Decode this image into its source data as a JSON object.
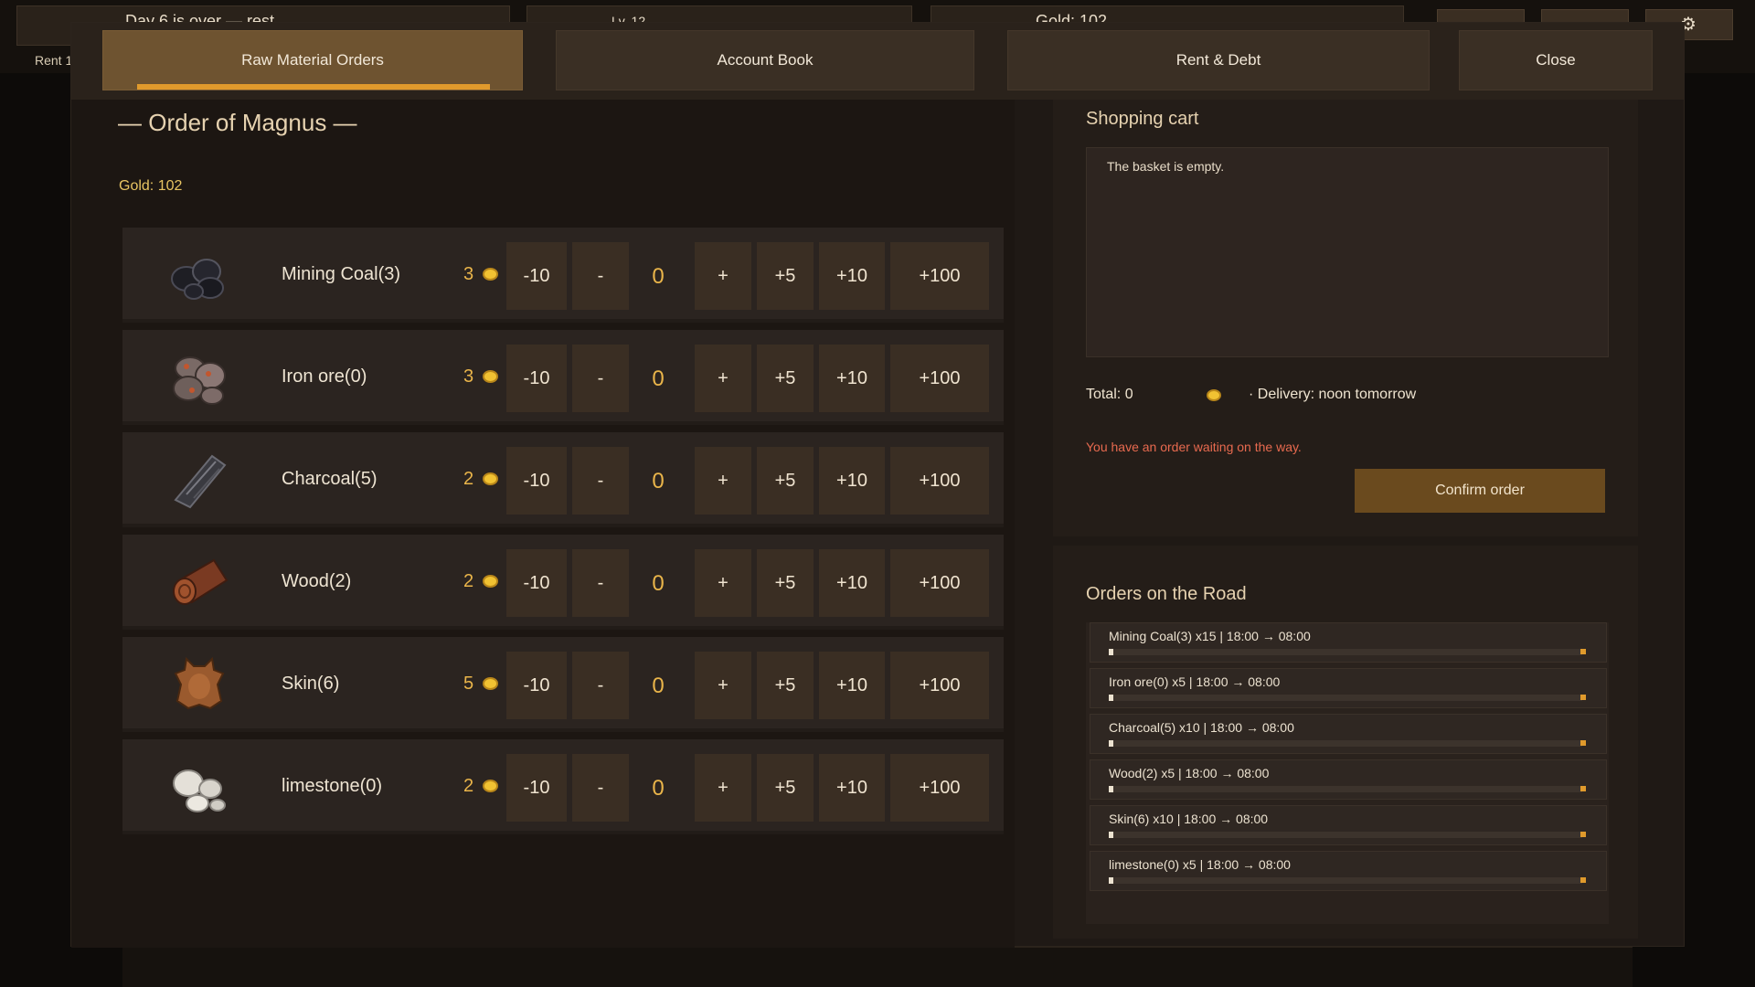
{
  "hud": {
    "day_text": "Day 6 is over — rest",
    "level_text": "Lv. 12",
    "gold_text": "Gold: 102",
    "rent_text": "Rent 1"
  },
  "tabs": [
    {
      "label": "Raw Material Orders",
      "active": true
    },
    {
      "label": "Account Book",
      "active": false
    },
    {
      "label": "Rent & Debt",
      "active": false
    },
    {
      "label": "Close",
      "active": false
    }
  ],
  "order": {
    "title": "— Order of Magnus —",
    "gold": "Gold: 102",
    "buttons": {
      "minus10": "-10",
      "minus": "-",
      "plus": "+",
      "plus5": "+5",
      "plus10": "+10",
      "plus100": "+100"
    },
    "items": [
      {
        "name": "Mining Coal(3)",
        "price": "3",
        "qty": "0",
        "icon": "coal-icon"
      },
      {
        "name": "Iron ore(0)",
        "price": "3",
        "qty": "0",
        "icon": "iron-ore-icon"
      },
      {
        "name": "Charcoal(5)",
        "price": "2",
        "qty": "0",
        "icon": "charcoal-icon"
      },
      {
        "name": "Wood(2)",
        "price": "2",
        "qty": "0",
        "icon": "wood-log-icon"
      },
      {
        "name": "Skin(6)",
        "price": "5",
        "qty": "0",
        "icon": "animal-skin-icon"
      },
      {
        "name": "limestone(0)",
        "price": "2",
        "qty": "0",
        "icon": "limestone-icon"
      }
    ]
  },
  "cart": {
    "title": "Shopping cart",
    "empty_text": "The basket is empty.",
    "total": "Total: 0",
    "delivery": "· Delivery: noon tomorrow",
    "warning": "You have an order waiting on the way.",
    "confirm_label": "Confirm order"
  },
  "road": {
    "title": "Orders on the Road",
    "items": [
      {
        "label": "Mining Coal(3) x15 | 18:00 → 08:00",
        "progress": 0.01
      },
      {
        "label": "Iron ore(0) x5 | 18:00 → 08:00",
        "progress": 0.01
      },
      {
        "label": "Charcoal(5) x10 | 18:00 → 08:00",
        "progress": 0.01
      },
      {
        "label": "Wood(2) x5 | 18:00 → 08:00",
        "progress": 0.01
      },
      {
        "label": "Skin(6) x10 | 18:00 → 08:00",
        "progress": 0.01
      },
      {
        "label": "limestone(0) x5 | 18:00 → 08:00",
        "progress": 0.01
      }
    ]
  }
}
